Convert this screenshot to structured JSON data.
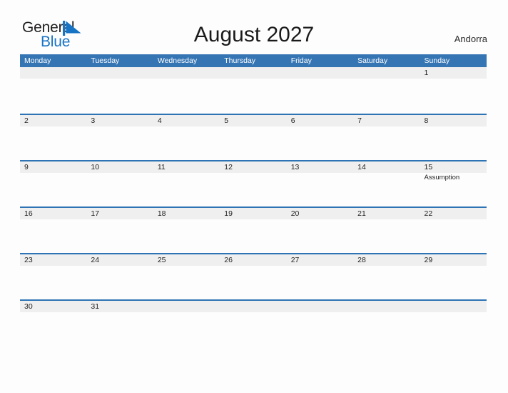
{
  "brand": {
    "word_general": "General",
    "word_blue": "Blue",
    "flag_color": "#1773c4",
    "general_color": "#221f1f"
  },
  "header": {
    "title": "August 2027",
    "locale": "Andorra"
  },
  "theme": {
    "header_bar": "#3575b4",
    "row_border": "#2e74b5",
    "day_band": "#efefef",
    "page_background": "#fdfdfd",
    "text": "#1f1f1f"
  },
  "calendar": {
    "weekday_headers": [
      "Monday",
      "Tuesday",
      "Wednesday",
      "Thursday",
      "Friday",
      "Saturday",
      "Sunday"
    ],
    "weeks": [
      [
        {
          "day": ""
        },
        {
          "day": ""
        },
        {
          "day": ""
        },
        {
          "day": ""
        },
        {
          "day": ""
        },
        {
          "day": ""
        },
        {
          "day": "1",
          "events": []
        }
      ],
      [
        {
          "day": "2",
          "events": []
        },
        {
          "day": "3",
          "events": []
        },
        {
          "day": "4",
          "events": []
        },
        {
          "day": "5",
          "events": []
        },
        {
          "day": "6",
          "events": []
        },
        {
          "day": "7",
          "events": []
        },
        {
          "day": "8",
          "events": []
        }
      ],
      [
        {
          "day": "9",
          "events": []
        },
        {
          "day": "10",
          "events": []
        },
        {
          "day": "11",
          "events": []
        },
        {
          "day": "12",
          "events": []
        },
        {
          "day": "13",
          "events": []
        },
        {
          "day": "14",
          "events": []
        },
        {
          "day": "15",
          "events": [
            "Assumption"
          ]
        }
      ],
      [
        {
          "day": "16",
          "events": []
        },
        {
          "day": "17",
          "events": []
        },
        {
          "day": "18",
          "events": []
        },
        {
          "day": "19",
          "events": []
        },
        {
          "day": "20",
          "events": []
        },
        {
          "day": "21",
          "events": []
        },
        {
          "day": "22",
          "events": []
        }
      ],
      [
        {
          "day": "23",
          "events": []
        },
        {
          "day": "24",
          "events": []
        },
        {
          "day": "25",
          "events": []
        },
        {
          "day": "26",
          "events": []
        },
        {
          "day": "27",
          "events": []
        },
        {
          "day": "28",
          "events": []
        },
        {
          "day": "29",
          "events": []
        }
      ],
      [
        {
          "day": "30",
          "events": []
        },
        {
          "day": "31",
          "events": []
        },
        {
          "day": ""
        },
        {
          "day": ""
        },
        {
          "day": ""
        },
        {
          "day": ""
        },
        {
          "day": ""
        }
      ]
    ]
  }
}
